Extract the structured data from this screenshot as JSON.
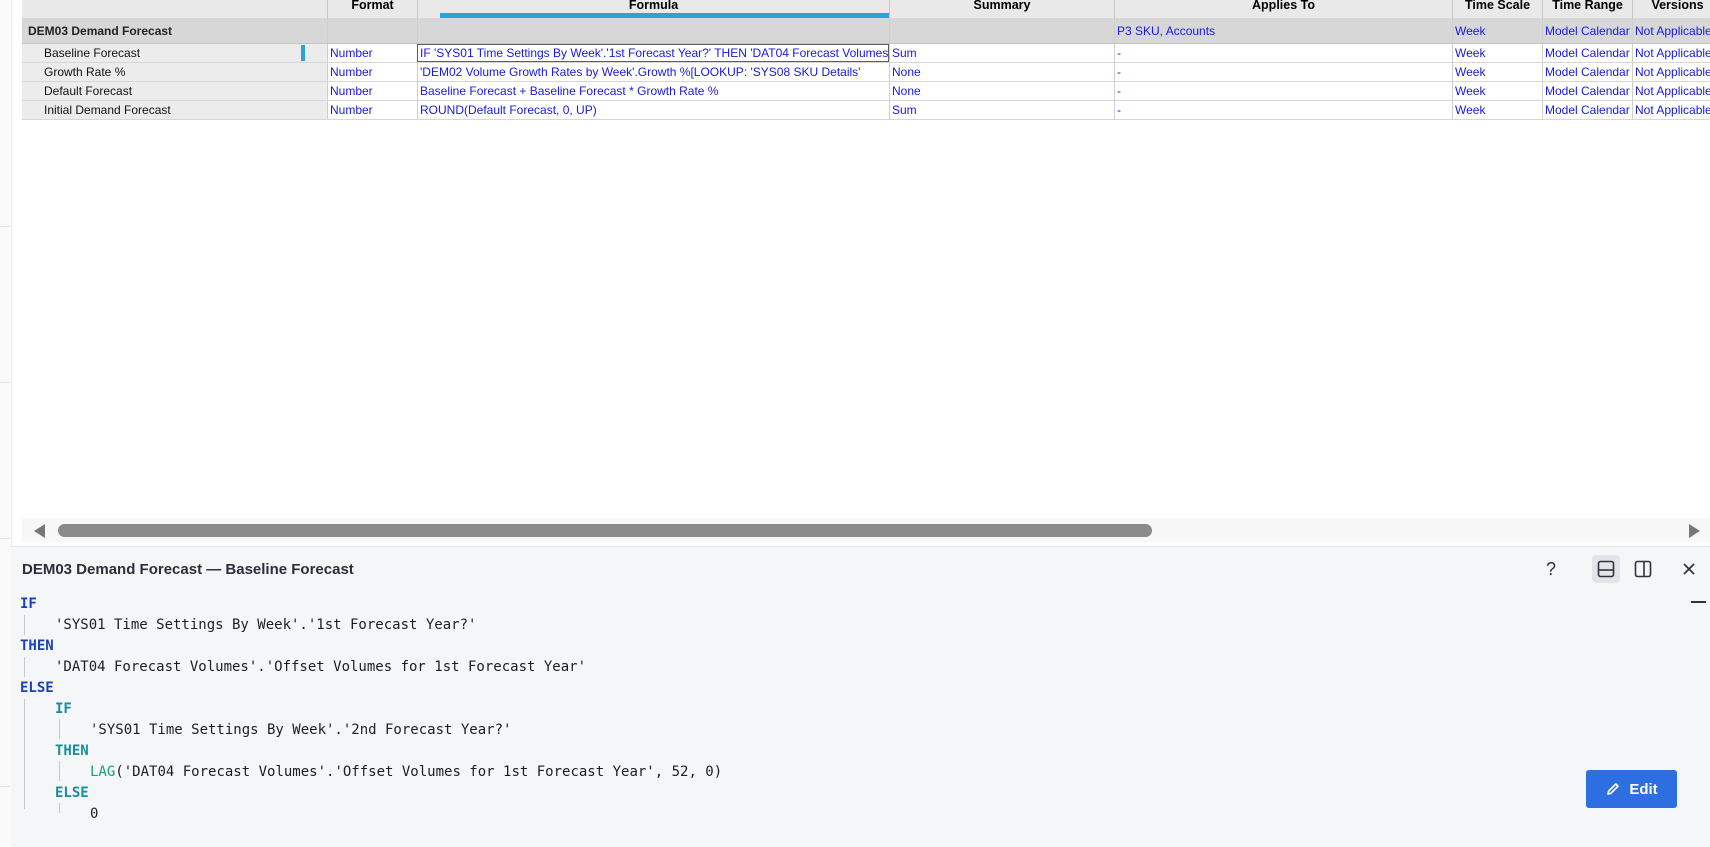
{
  "columns": {
    "name": "",
    "format": "Format",
    "formula": "Formula",
    "summary": "Summary",
    "applies_to": "Applies To",
    "time_scale": "Time Scale",
    "time_range": "Time Range",
    "versions": "Versions"
  },
  "group_row": {
    "name": "DEM03 Demand Forecast",
    "format": "",
    "formula": "",
    "summary": "",
    "applies_to": "P3 SKU, Accounts",
    "time_scale": "Week",
    "time_range": "Model Calendar",
    "versions": "Not Applicable"
  },
  "rows": [
    {
      "name": "Baseline Forecast",
      "format": "Number",
      "formula": "IF 'SYS01 Time Settings By Week'.'1st Forecast Year?' THEN 'DAT04 Forecast Volumes'.'Offset Volumes for 1st Forecast Year'",
      "summary": "Sum",
      "applies_to": "-",
      "time_scale": "Week",
      "time_range": "Model Calendar",
      "versions": "Not Applicable"
    },
    {
      "name": "Growth Rate %",
      "format": "Number",
      "formula": "'DEM02 Volume Growth Rates by Week'.Growth %[LOOKUP: 'SYS08 SKU Details'",
      "summary": "None",
      "applies_to": "-",
      "time_scale": "Week",
      "time_range": "Model Calendar",
      "versions": "Not Applicable"
    },
    {
      "name": "Default Forecast",
      "format": "Number",
      "formula": "Baseline Forecast + Baseline Forecast * Growth Rate %",
      "summary": "None",
      "applies_to": "-",
      "time_scale": "Week",
      "time_range": "Model Calendar",
      "versions": "Not Applicable"
    },
    {
      "name": "Initial Demand Forecast",
      "format": "Number",
      "formula": "ROUND(Default Forecast, 0, UP)",
      "summary": "Sum",
      "applies_to": "-",
      "time_scale": "Week",
      "time_range": "Model Calendar",
      "versions": "Not Applicable"
    }
  ],
  "panel": {
    "title": "DEM03 Demand Forecast — Baseline Forecast",
    "help_label": "?",
    "edit_label": "Edit",
    "code": {
      "l1": "IF",
      "l2": "'SYS01 Time Settings By Week'.'1st Forecast Year?'",
      "l3": "THEN",
      "l4": "'DAT04 Forecast Volumes'.'Offset Volumes for 1st Forecast Year'",
      "l5": "ELSE",
      "l6": "IF",
      "l7": "'SYS01 Time Settings By Week'.'2nd Forecast Year?'",
      "l8": "THEN",
      "l9_fn": "LAG",
      "l9_rest": "('DAT04 Forecast Volumes'.'Offset Volumes for 1st Forecast Year', 52, 0)",
      "l10": "ELSE",
      "l11": "0"
    }
  },
  "icons": {
    "help": "help-icon",
    "layout_bottom": "dock-bottom-icon",
    "layout_side": "dock-side-icon",
    "close": "close-icon",
    "edit": "pencil-icon",
    "scroll_left": "scroll-left-arrow-icon",
    "scroll_right": "scroll-right-arrow-icon"
  },
  "colors": {
    "accent_blue": "#2aa3d8",
    "link_text": "#1a1ad8",
    "edit_button": "#2d6fe0",
    "keyword": "#1a42b5",
    "nested_keyword": "#198e9a",
    "function": "#17a07a"
  }
}
